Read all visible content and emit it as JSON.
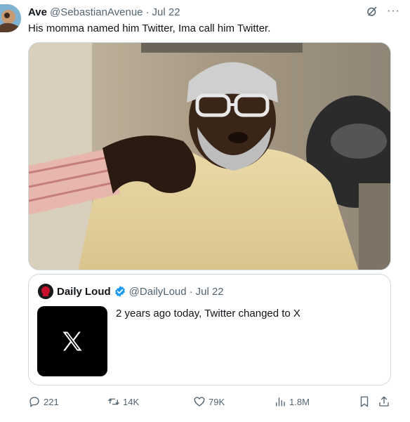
{
  "tweet": {
    "author_name": "Ave",
    "handle": "@SebastianAvenue",
    "separator": "·",
    "date": "Jul 22",
    "text": "His momma named him Twitter, Ima call him Twitter.",
    "more_label": "···"
  },
  "quote": {
    "author_name": "Daily Loud",
    "handle": "@DailyLoud",
    "separator": "·",
    "date": "Jul 22",
    "text": "2 years ago today, Twitter changed to X",
    "thumb_glyph": "X"
  },
  "actions": {
    "replies": "221",
    "reposts": "14K",
    "likes": "79K",
    "views": "1.8M"
  },
  "colors": {
    "text": "#0f1419",
    "secondary": "#536471",
    "verified": "#1d9bf0",
    "border": "#cfd9de"
  }
}
